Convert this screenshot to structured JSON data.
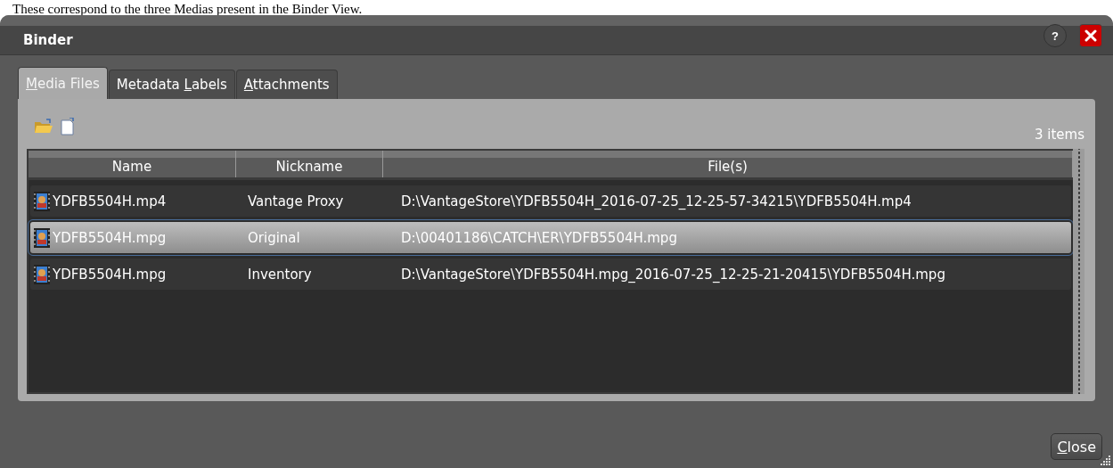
{
  "caption": "These correspond to the three Medias present in the Binder View.",
  "window": {
    "title": "Binder",
    "help_button": "?"
  },
  "tabs": [
    {
      "key": "M",
      "after": "edia Files",
      "selected": true
    },
    {
      "before": "Metadata ",
      "key": "L",
      "after": "abels",
      "selected": false
    },
    {
      "key": "A",
      "after": "ttachments",
      "selected": false
    }
  ],
  "item_count": "3 items",
  "table": {
    "columns": [
      "Name",
      "Nickname",
      "File(s)"
    ],
    "rows": [
      {
        "name": "YDFB5504H.mp4",
        "nickname": "Vantage Proxy",
        "files": "D:\\VantageStore\\YDFB5504H_2016-07-25_12-25-57-34215\\YDFB5504H.mp4",
        "selected": false
      },
      {
        "name": "YDFB5504H.mpg",
        "nickname": "Original",
        "files": "D:\\00401186\\CATCH\\ER\\YDFB5504H.mpg",
        "selected": true
      },
      {
        "name": "YDFB5504H.mpg",
        "nickname": "Inventory",
        "files": "D:\\VantageStore\\YDFB5504H.mpg_2016-07-25_12-25-21-20415\\YDFB5504H.mpg",
        "selected": false
      }
    ]
  },
  "close_button": {
    "key": "C",
    "after": "lose"
  }
}
